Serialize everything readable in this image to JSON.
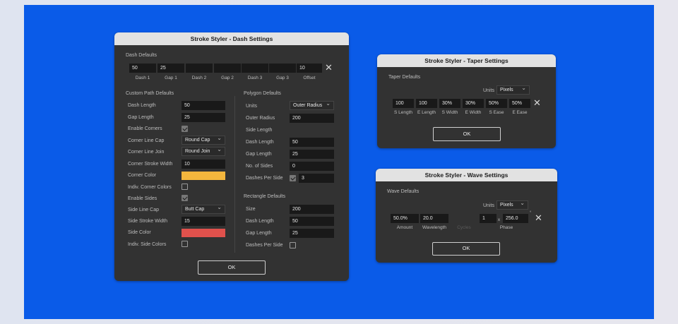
{
  "colors": {
    "canvas": "#0a5be8",
    "corner": "#f3b63d",
    "side": "#e0514c"
  },
  "dash": {
    "title": "Stroke Styler - Dash Settings",
    "defaults_label": "Dash Defaults",
    "fields": [
      {
        "value": "50",
        "caption": "Dash 1"
      },
      {
        "value": "25",
        "caption": "Gap 1"
      },
      {
        "value": "",
        "caption": "Dash 2"
      },
      {
        "value": "",
        "caption": "Gap 2"
      },
      {
        "value": "",
        "caption": "Dash 3"
      },
      {
        "value": "",
        "caption": "Gap 3"
      },
      {
        "value": "10",
        "caption": "Offset"
      }
    ],
    "custom_path": {
      "heading": "Custom Path Defaults",
      "dash_length_label": "Dash Length",
      "dash_length": "50",
      "gap_length_label": "Gap Length",
      "gap_length": "25",
      "enable_corners_label": "Enable Corners",
      "corner_cap_label": "Corner Line Cap",
      "corner_cap": "Round Cap",
      "corner_join_label": "Corner Line Join",
      "corner_join": "Round Join",
      "corner_width_label": "Corner Stroke Width",
      "corner_width": "10",
      "corner_color_label": "Corner Color",
      "indiv_corner_label": "Indiv. Corner Colors",
      "enable_sides_label": "Enable Sides",
      "side_cap_label": "Side Line Cap",
      "side_cap": "Butt Cap",
      "side_width_label": "Side Stroke Width",
      "side_width": "15",
      "side_color_label": "Side Color",
      "indiv_side_label": "Indiv. Side Colors"
    },
    "polygon": {
      "heading": "Polygon Defaults",
      "units_label": "Units",
      "units": "Outer Radius",
      "outer_radius_label": "Outer Radius",
      "outer_radius": "200",
      "side_length_label": "Side Length",
      "dash_length_label": "Dash Length",
      "dash_length": "50",
      "gap_length_label": "Gap Length",
      "gap_length": "25",
      "sides_label": "No. of Sides",
      "sides": "0",
      "dps_label": "Dashes Per Side",
      "dps": "3"
    },
    "rectangle": {
      "heading": "Rectangle Defaults",
      "size_label": "Size",
      "size": "200",
      "dash_length_label": "Dash Length",
      "dash_length": "50",
      "gap_length_label": "Gap Length",
      "gap_length": "25",
      "dps_label": "Dashes Per Side"
    },
    "ok": "OK"
  },
  "taper": {
    "title": "Stroke Styler - Taper Settings",
    "defaults_label": "Taper Defaults",
    "units_label": "Units",
    "units": "Pixels",
    "fields": [
      {
        "value": "100",
        "caption": "S Length"
      },
      {
        "value": "100",
        "caption": "E Length"
      },
      {
        "value": "30%",
        "caption": "S Width"
      },
      {
        "value": "30%",
        "caption": "E Width"
      },
      {
        "value": "50%",
        "caption": "S Ease"
      },
      {
        "value": "50%",
        "caption": "E Ease"
      }
    ],
    "ok": "OK"
  },
  "wave": {
    "title": "Stroke Styler - Wave Settings",
    "defaults_label": "Wave Defaults",
    "units_label": "Units",
    "units": "Pixels",
    "amount": "50.0%",
    "amount_caption": "Amount",
    "wavelength": "20.0",
    "wavelength_caption": "Wavelength",
    "cycles_caption": "Cycles",
    "phase_a": "1",
    "phase_x": "x",
    "phase_b": "256.0",
    "phase_deg": "°",
    "phase_caption": "Phase",
    "ok": "OK"
  }
}
